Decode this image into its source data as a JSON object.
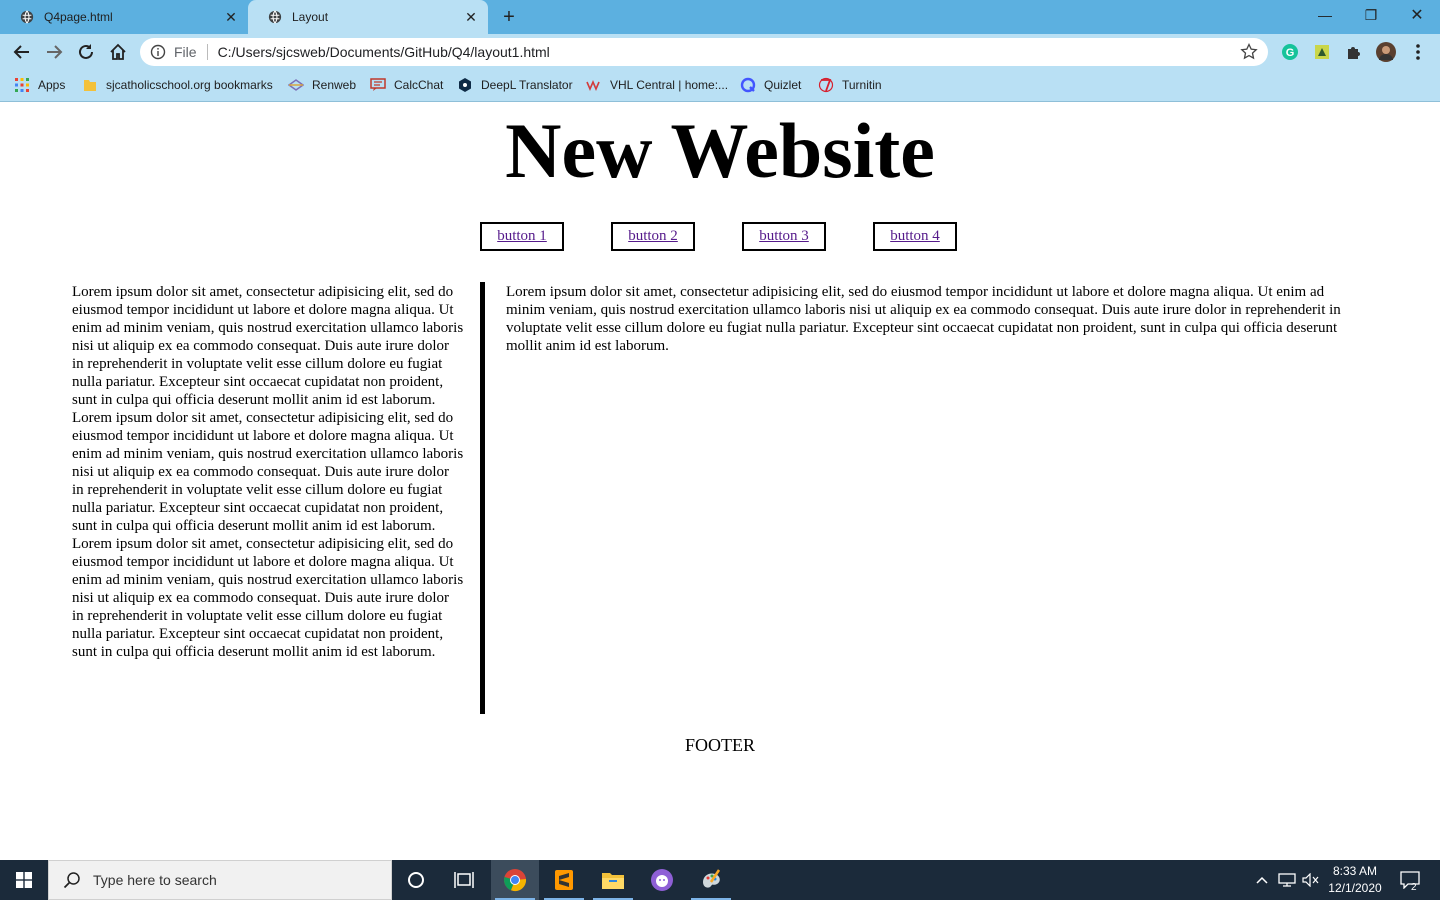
{
  "browser": {
    "tabs": [
      {
        "label": "Q4page.html",
        "active": false
      },
      {
        "label": "Layout",
        "active": true
      }
    ],
    "address": {
      "file_label": "File",
      "url": "C:/Users/sjcsweb/Documents/GitHub/Q4/layout1.html"
    },
    "bookmarks": [
      "Apps",
      "sjcatholicschool.org bookmarks",
      "Renweb",
      "CalcChat",
      "DeepL Translator",
      "VHL Central | home:...",
      "Quizlet",
      "Turnitin"
    ]
  },
  "page": {
    "title": "New Website",
    "buttons": [
      "button 1",
      "button 2",
      "button 3",
      "button 4"
    ],
    "left_paragraphs": [
      "Lorem ipsum dolor sit amet, consectetur adipisicing elit, sed do eiusmod tempor incididunt ut labore et dolore magna aliqua. Ut enim ad minim veniam, quis nostrud exercitation ullamco laboris nisi ut aliquip ex ea commodo consequat. Duis aute irure dolor in reprehenderit in voluptate velit esse cillum dolore eu fugiat nulla pariatur. Excepteur sint occaecat cupidatat non proident, sunt in culpa qui officia deserunt mollit anim id est laborum.",
      "Lorem ipsum dolor sit amet, consectetur adipisicing elit, sed do eiusmod tempor incididunt ut labore et dolore magna aliqua. Ut enim ad minim veniam, quis nostrud exercitation ullamco laboris nisi ut aliquip ex ea commodo consequat. Duis aute irure dolor in reprehenderit in voluptate velit esse cillum dolore eu fugiat nulla pariatur. Excepteur sint occaecat cupidatat non proident, sunt in culpa qui officia deserunt mollit anim id est laborum.",
      "Lorem ipsum dolor sit amet, consectetur adipisicing elit, sed do eiusmod tempor incididunt ut labore et dolore magna aliqua. Ut enim ad minim veniam, quis nostrud exercitation ullamco laboris nisi ut aliquip ex ea commodo consequat. Duis aute irure dolor in reprehenderit in voluptate velit esse cillum dolore eu fugiat nulla pariatur. Excepteur sint occaecat cupidatat non proident, sunt in culpa qui officia deserunt mollit anim id est laborum."
    ],
    "right_paragraph": "Lorem ipsum dolor sit amet, consectetur adipisicing elit, sed do eiusmod tempor incididunt ut labore et dolore magna aliqua. Ut enim ad minim veniam, quis nostrud exercitation ullamco laboris nisi ut aliquip ex ea commodo consequat. Duis aute irure dolor in reprehenderit in voluptate velit esse cillum dolore eu fugiat nulla pariatur. Excepteur sint occaecat cupidatat non proident, sunt in culpa qui officia deserunt mollit anim id est laborum.",
    "footer": "FOOTER"
  },
  "taskbar": {
    "search_placeholder": "Type here to search",
    "time": "8:33 AM",
    "date": "12/1/2020",
    "notifications": "2"
  },
  "colors": {
    "tabstrip": "#5cb0e0",
    "toolbar": "#b9e0f4",
    "link": "#551a8b",
    "taskbar": "#1b2a3a"
  }
}
